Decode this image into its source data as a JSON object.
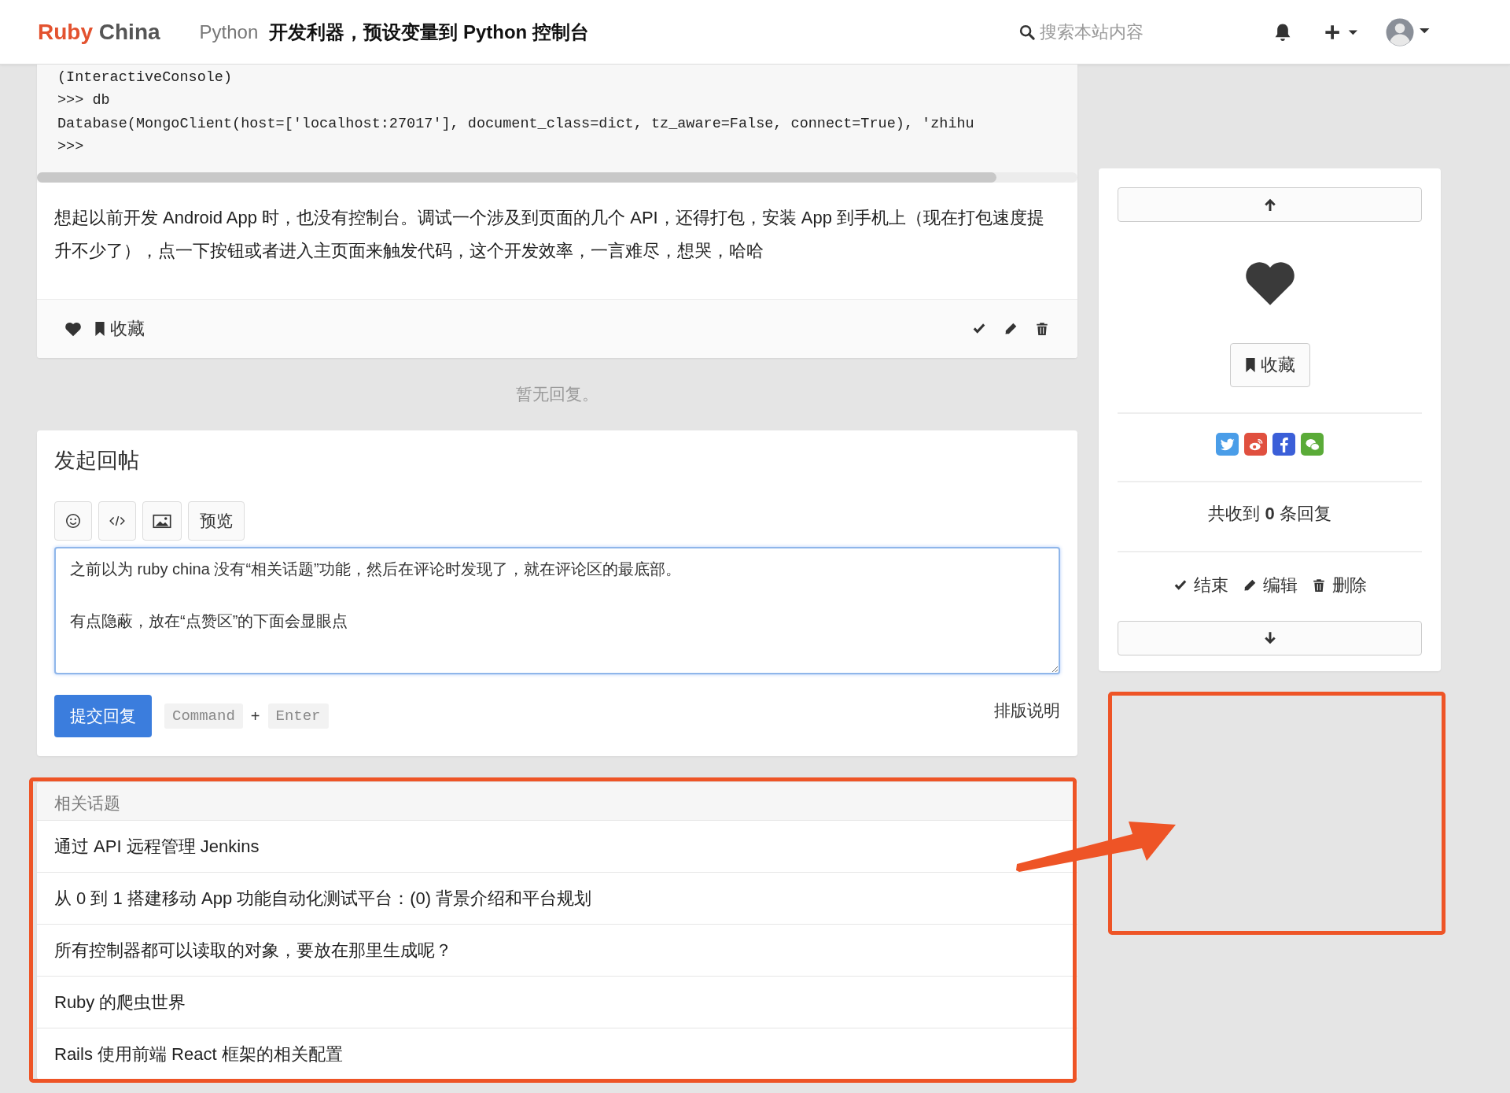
{
  "header": {
    "logo": {
      "first": "Ruby",
      "second": "China"
    },
    "topic_node": "Python",
    "topic_title": "开发利器，预设变量到 Python 控制台",
    "search": {
      "placeholder": "搜索本站内容"
    }
  },
  "article": {
    "code_lines": [
      "(InteractiveConsole)",
      ">>> db",
      "Database(MongoClient(host=['localhost:27017'], document_class=dict, tz_aware=False, connect=True), 'zhihu",
      ">>>"
    ],
    "paragraph": "想起以前开发 Android App 时，也没有控制台。调试一个涉及到页面的几个 API，还得打包，安装 App 到手机上（现在打包速度提升不少了），点一下按钮或者进入主页面来触发代码，这个开发效率，一言难尽，想哭，哈哈",
    "bookmark_label": "收藏"
  },
  "no_reply_text": "暂无回复。",
  "reply_form": {
    "title": "发起回帖",
    "toolbar": [
      {
        "kind": "emoji"
      },
      {
        "kind": "code"
      },
      {
        "kind": "image"
      },
      {
        "kind": "text",
        "label": "预览"
      }
    ],
    "value_lines": [
      "之前以为 ruby china 没有“相关话题”功能，然后在评论时发现了，就在评论区的最底部。",
      "有点隐蔽，放在“点赞区”的下面会显眼点"
    ],
    "submit_label": "提交回复",
    "hotkey": {
      "keys": [
        "Command",
        "Enter"
      ],
      "separator": "+"
    },
    "help_link": "排版说明"
  },
  "related_topics": {
    "title": "相关话题",
    "items": [
      "通过 API 远程管理 Jenkins",
      "从 0 到 1 搭建移动 App 功能自动化测试平台：(0) 背景介绍和平台规划",
      "所有控制器都可以读取的对象，要放在那里生成呢？",
      "Ruby 的爬虫世界",
      "Rails 使用前端 React 框架的相关配置"
    ]
  },
  "sidebar": {
    "bookmark_label": "收藏",
    "share": [
      {
        "kind": "twitter",
        "color": "#4a9de8"
      },
      {
        "kind": "weibo",
        "color": "#e0503f"
      },
      {
        "kind": "facebook",
        "color": "#3b5fd8"
      },
      {
        "kind": "wechat",
        "color": "#5aab38"
      }
    ],
    "reply_count": {
      "prefix": "共收到",
      "count": "0",
      "suffix": "条回复"
    },
    "actions": [
      {
        "kind": "close",
        "label": "结束"
      },
      {
        "kind": "edit",
        "label": "编辑"
      },
      {
        "kind": "delete",
        "label": "删除"
      }
    ]
  }
}
